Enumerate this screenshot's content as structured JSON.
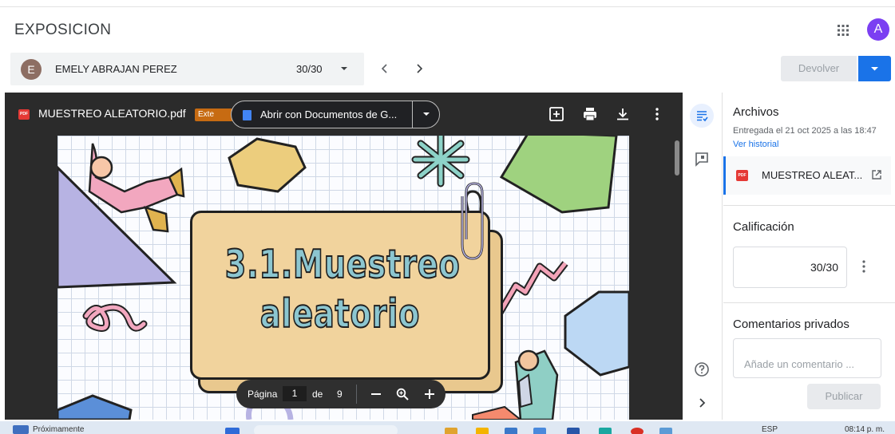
{
  "header": {
    "title": "EXPOSICION",
    "avatar_initial": "A"
  },
  "student": {
    "avatar_initial": "E",
    "name": "EMELY ABRAJAN PEREZ",
    "grade": "30/30"
  },
  "actions": {
    "return_label": "Devolver"
  },
  "viewer": {
    "file_name": "MUESTREO ALEATORIO.pdf",
    "ext_chip": "Exte",
    "open_with_label": "Abrir con Documentos de G...",
    "slide": {
      "title_line1": "3.1.Muestreo",
      "title_line2": "aleatorio"
    },
    "pagination": {
      "label": "Página",
      "current": "1",
      "of": "de",
      "total": "9"
    }
  },
  "panel": {
    "files_title": "Archivos",
    "submitted_text": "Entregada el 21 oct 2025 a las 18:47",
    "history_link": "Ver historial",
    "file_name": "MUESTREO ALEAT...",
    "grade_title": "Calificación",
    "grade_value": "30/30",
    "comments_title": "Comentarios privados",
    "comment_placeholder": "Añade un comentario ...",
    "publish_label": "Publicar"
  },
  "taskbar": {
    "left_text": "Próximamente",
    "clock_text": "08:14 p. m.",
    "lang_text": "ESP"
  },
  "colors": {
    "accent": "#1a73e8",
    "avatar_purple": "#7b3ff2",
    "viewer_bg": "#2b2b2b",
    "slide_card": "#f1d39d",
    "slide_title_fill": "#8cc6d0"
  }
}
